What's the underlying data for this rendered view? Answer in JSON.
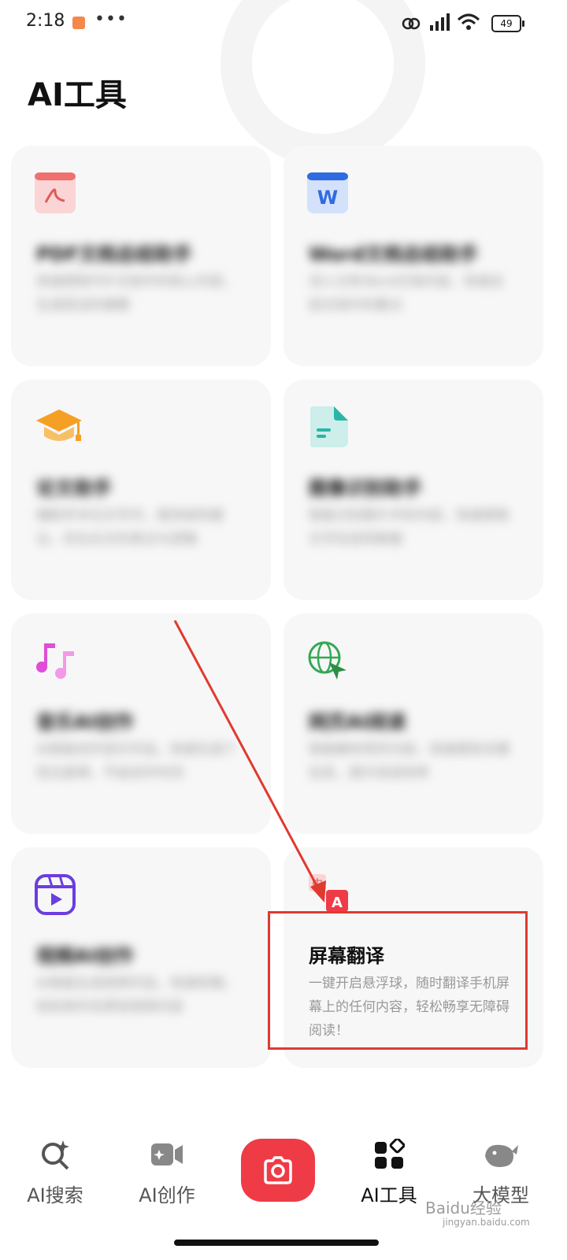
{
  "status_bar": {
    "time": "2:18",
    "more": "•••",
    "battery": "49"
  },
  "page": {
    "title": "AI工具"
  },
  "cards": [
    {
      "name": "PDF文档总结助手",
      "desc": "快速提取PDF文档中的核心内容，生成简洁的摘要"
    },
    {
      "name": "Word文档总结助手",
      "desc": "深入分析Word文档内容，快速总结文档中的要点"
    },
    {
      "name": "论文助手",
      "desc": "辅助学术论文写作，提供结构建议，优化论文的表达与逻辑"
    },
    {
      "name": "图像识别助手",
      "desc": "智能识别图片中的内容，快速提取文字信息和数据"
    },
    {
      "name": "音乐AI创作",
      "desc": "AI智能创作音乐作品，快速生成个性化旋律，节省创作时间"
    },
    {
      "name": "网页AI阅读",
      "desc": "智能解析网页内容，快速提炼关键信息，提升阅读效率"
    },
    {
      "name": "视频AI创作",
      "desc": "AI智能生成视频作品，快速剪辑，轻松制作优质短视频内容"
    },
    {
      "name": "屏幕翻译",
      "desc": "一键开启悬浮球，随时翻译手机屏幕上的任何内容，轻松畅享无障碍阅读！"
    }
  ],
  "tabs": [
    {
      "label": "AI搜索"
    },
    {
      "label": "AI创作"
    },
    {
      "label": "AI工具"
    },
    {
      "label": "大模型"
    }
  ],
  "watermark": {
    "brand": "Baidu经验",
    "url": "jingyan.baidu.com"
  },
  "colors": {
    "accent": "#ef3b46",
    "annotation": "#e03a2f",
    "card_bg": "#f7f7f8"
  }
}
